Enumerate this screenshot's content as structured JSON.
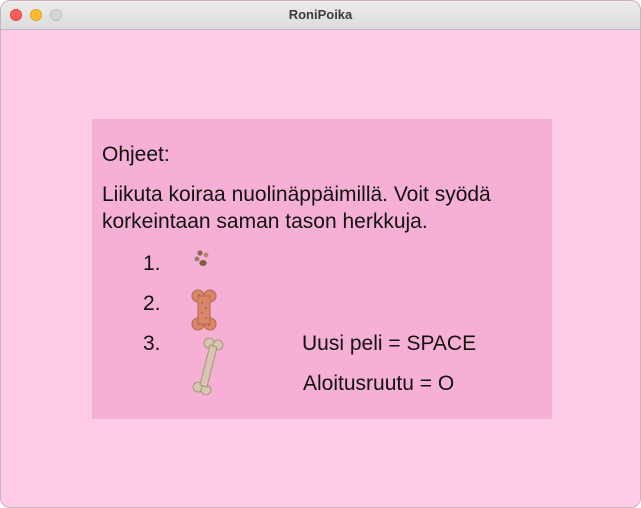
{
  "window": {
    "title": "RoniPoika"
  },
  "panel": {
    "heading": "Ohjeet:",
    "instructions": "Liikuta koiraa nuolinäppäimillä. Voit syödä korkeintaan saman tason herkkuja.",
    "levels": [
      {
        "number": "1.",
        "icon": "paw-treat-icon"
      },
      {
        "number": "2.",
        "icon": "dog-biscuit-bone-icon"
      },
      {
        "number": "3.",
        "icon": "bone-icon"
      }
    ],
    "new_game": "Uusi peli = SPACE",
    "start_square": "Aloitusruutu = O"
  },
  "colors": {
    "background": "#ffcce8",
    "panel": "#f7b0d5",
    "biscuit": "#d9876a",
    "bone": "#d8c7b0"
  }
}
